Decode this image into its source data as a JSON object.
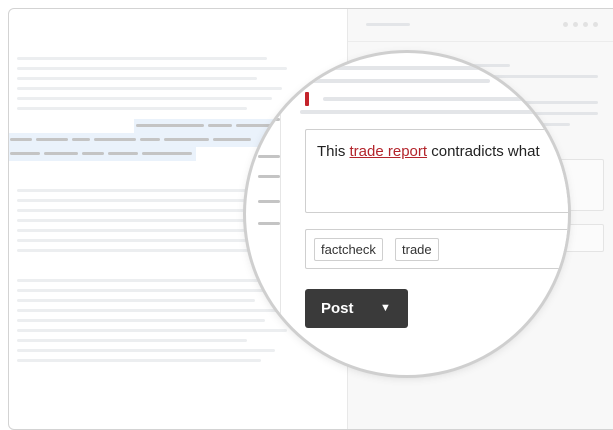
{
  "compose": {
    "text_before": "This ",
    "link_text": "trade report",
    "text_after": " contradicts what"
  },
  "tags": [
    "factcheck",
    "trade"
  ],
  "post_button": {
    "label": "Post",
    "caret": "▼"
  },
  "colors": {
    "link": "#b3242b",
    "button": "#3a3a3a",
    "highlight": "#eaf2fb"
  }
}
